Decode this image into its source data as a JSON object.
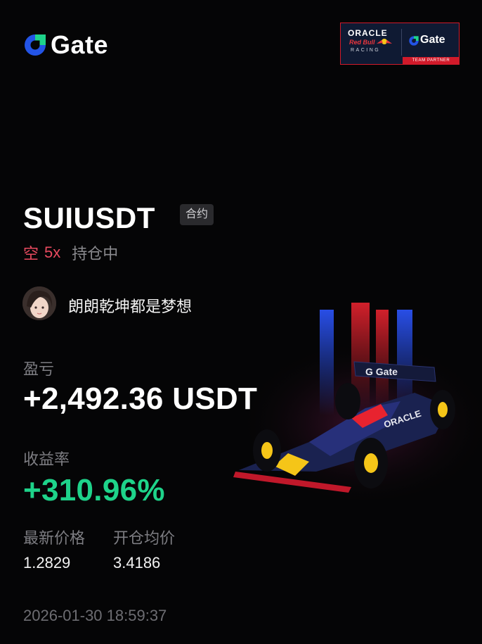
{
  "brand": {
    "logo_text": "Gate",
    "accent": "#2354e6"
  },
  "partner_badge": {
    "oracle": "ORACLE",
    "redbull": "Red Bull",
    "racing": "RACING",
    "gate": "Gate",
    "partner": "TEAM PARTNER"
  },
  "position": {
    "pair": "SUIUSDT",
    "type_tag": "合约",
    "side": "空",
    "leverage": "5x",
    "status": "持仓中"
  },
  "user": {
    "name": "朗朗乾坤都是梦想"
  },
  "pnl": {
    "label": "盈亏",
    "value": "+2,492.36 USDT"
  },
  "roi": {
    "label": "收益率",
    "value": "+310.96%",
    "color": "#1ed38a"
  },
  "prices": {
    "latest_label": "最新价格",
    "latest_value": "1.2829",
    "entry_label": "开仓均价",
    "entry_value": "3.4186"
  },
  "timestamp": "2026-01-30 18:59:37",
  "colors": {
    "short": "#e84a5f",
    "background": "#050506"
  }
}
